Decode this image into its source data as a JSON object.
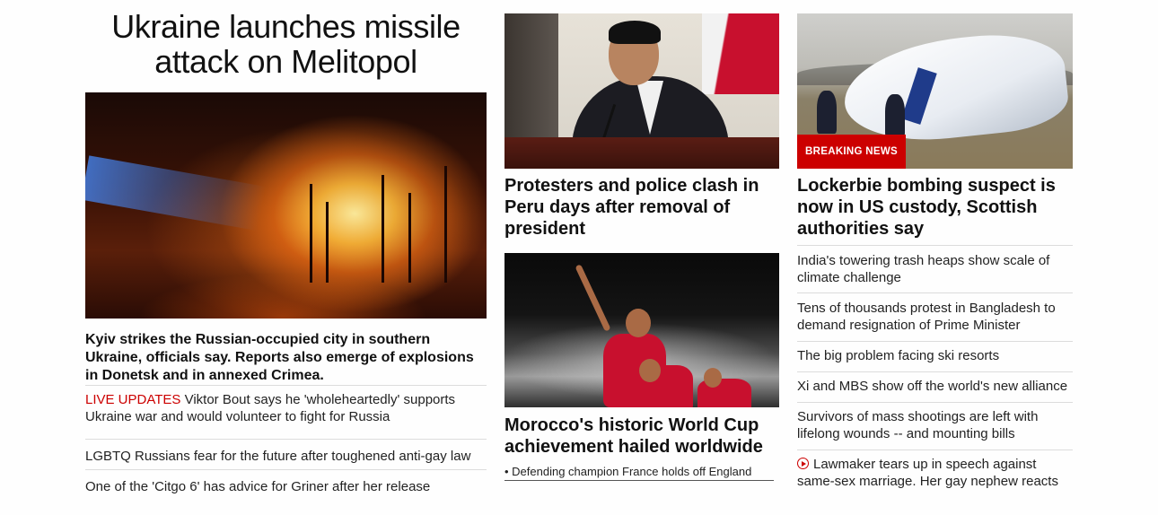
{
  "col1": {
    "title": "Ukraine launches missile attack on Melitopol",
    "lead": "Kyiv strikes the Russian-occupied city in southern Ukraine, officials say. Reports also emerge of explosions in Donetsk and in annexed Crimea.",
    "items": [
      {
        "tag": "LIVE UPDATES",
        "text": " Viktor Bout says he 'wholeheartedly' supports Ukraine war and would volunteer to fight for Russia"
      },
      {
        "text": "LGBTQ Russians fear for the future after toughened anti-gay law"
      },
      {
        "text": "One of the 'Citgo 6' has advice for Griner after her release"
      }
    ]
  },
  "col2": {
    "headline1": "Protesters and police clash in Peru days after removal of president",
    "headline2": "Morocco's historic World Cup achievement hailed worldwide",
    "bullet": "• Defending champion France holds off England"
  },
  "col3": {
    "badge": "BREAKING NEWS",
    "headline": "Lockerbie bombing suspect is now in US custody, Scottish authorities say",
    "items": [
      "India's towering trash heaps show scale of climate challenge",
      "Tens of thousands protest in Bangladesh to demand resignation of Prime Minister",
      "The big problem facing ski resorts",
      "Xi and MBS show off the world's new alliance",
      "Survivors of mass shootings are left with lifelong wounds -- and mounting bills",
      "Lawmaker tears up in speech against same-sex marriage. Her gay nephew reacts"
    ]
  },
  "colors": {
    "accent_red": "#cc0000",
    "text": "#0c0c0c",
    "divider": "#dcdcdc"
  }
}
